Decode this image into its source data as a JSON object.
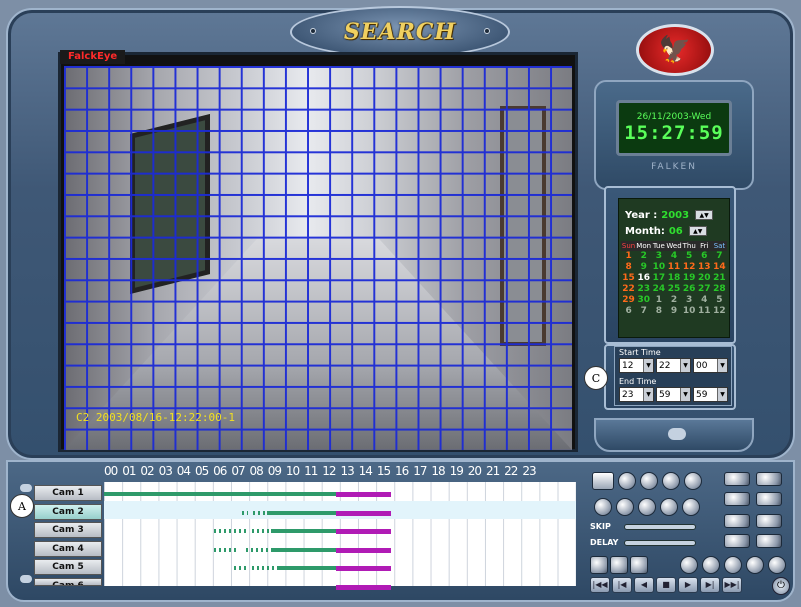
{
  "title": "SEARCH",
  "video": {
    "tag": "FalckEye",
    "stamp": "C2 2003/08/16-12:22:00-1"
  },
  "clock": {
    "date": "26/11/2003-Wed",
    "time": "15:27:59",
    "brand": "FALKEN"
  },
  "calendar": {
    "year_label": "Year :",
    "year_value": "2003",
    "month_label": "Month:",
    "month_value": "06",
    "weekdays": [
      "Sun",
      "Mon",
      "Tue",
      "Wed",
      "Thu",
      "Fri",
      "Sat"
    ],
    "days": [
      "1",
      "2",
      "3",
      "4",
      "5",
      "6",
      "7",
      "8",
      "9",
      "10",
      "11",
      "12",
      "13",
      "14",
      "15",
      "16",
      "17",
      "18",
      "19",
      "20",
      "21",
      "22",
      "23",
      "24",
      "25",
      "26",
      "27",
      "28",
      "29",
      "30",
      "1",
      "2",
      "3",
      "4",
      "5",
      "6",
      "7",
      "8",
      "9",
      "10",
      "11",
      "12"
    ],
    "highlight_colors": {
      "selected": "#ffffff",
      "sunday": "#ff6a1a",
      "normal": "#28c828",
      "next_month": "#a0b0a0"
    }
  },
  "time_range": {
    "start_label": "Start Time",
    "start": [
      "12",
      "22",
      "00"
    ],
    "end_label": "End Time",
    "end": [
      "23",
      "59",
      "59"
    ]
  },
  "callouts": {
    "a": "A",
    "c": "C"
  },
  "timeline": {
    "hours": [
      "00",
      "01",
      "02",
      "03",
      "04",
      "05",
      "06",
      "07",
      "08",
      "09",
      "10",
      "11",
      "12",
      "13",
      "14",
      "15",
      "16",
      "17",
      "18",
      "19",
      "20",
      "21",
      "22",
      "23"
    ],
    "cameras": [
      "Cam 1",
      "Cam 2",
      "Cam 3",
      "Cam 4",
      "Cam 5",
      "Cam 6"
    ],
    "active_camera": "Cam 2",
    "colors": {
      "recorded": "#2e9a6a",
      "selected": "#b01bb5"
    }
  },
  "controls": {
    "skip_label": "SKIP",
    "delay_label": "DELAY",
    "playback": [
      "|◀◀",
      "|◀",
      "◀",
      "■",
      "▶",
      "▶|",
      "▶▶|"
    ],
    "power_icon": "⏻"
  }
}
